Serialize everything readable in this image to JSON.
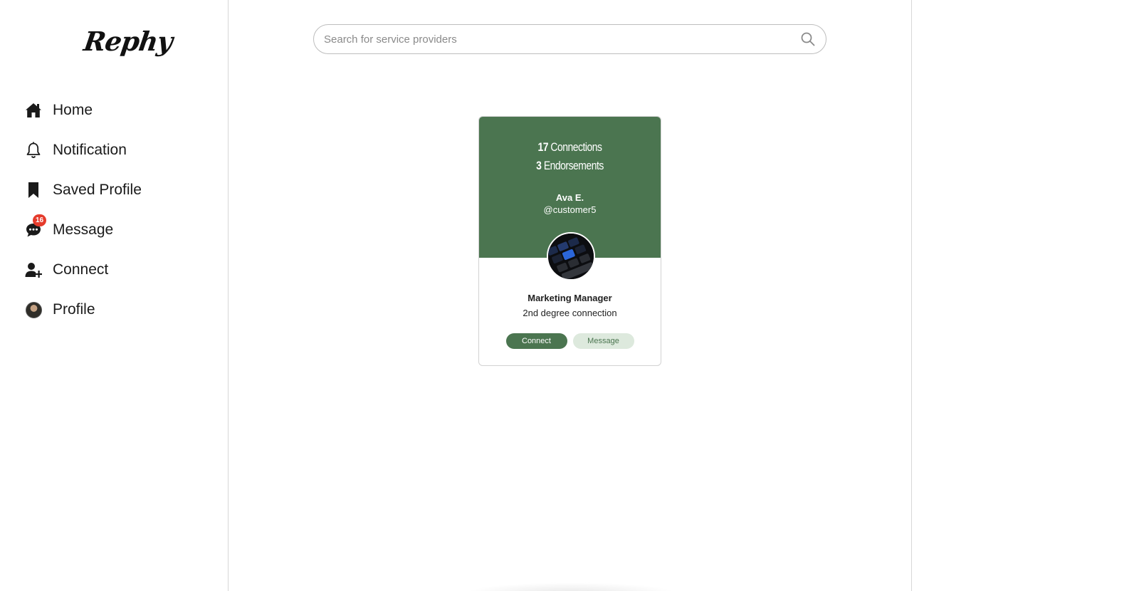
{
  "brand": {
    "logo": "Rephy"
  },
  "sidebar": {
    "items": [
      {
        "label": "Home",
        "icon": "home-icon"
      },
      {
        "label": "Notification",
        "icon": "bell-icon"
      },
      {
        "label": "Saved Profile",
        "icon": "bookmark-icon"
      },
      {
        "label": "Message",
        "icon": "chat-icon",
        "badge": "16"
      },
      {
        "label": "Connect",
        "icon": "add-user-icon"
      },
      {
        "label": "Profile",
        "icon": "avatar"
      }
    ]
  },
  "search": {
    "placeholder": "Search for service providers"
  },
  "card": {
    "connections_count": "17",
    "connections_label": "Connections",
    "endorsements_count": "3",
    "endorsements_label": "Endorsements",
    "name": "Ava E.",
    "handle": "@customer5",
    "job_title": "Marketing Manager",
    "degree": "2nd degree connection",
    "connect_label": "Connect",
    "message_label": "Message"
  },
  "colors": {
    "accent_green": "#4b7550",
    "light_green": "#dde9dd",
    "badge_red": "#e53b2c"
  }
}
